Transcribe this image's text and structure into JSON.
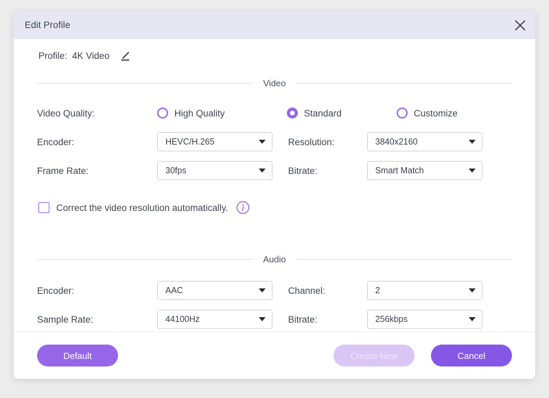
{
  "window": {
    "title": "Edit Profile",
    "close_icon": "close-icon"
  },
  "profile": {
    "label": "Profile:",
    "value": "4K Video",
    "edit_icon": "pencil-icon"
  },
  "video_section": {
    "title": "Video",
    "quality": {
      "label": "Video Quality:",
      "options": [
        {
          "label": "High Quality",
          "selected": false
        },
        {
          "label": "Standard",
          "selected": true
        },
        {
          "label": "Customize",
          "selected": false
        }
      ]
    },
    "encoder": {
      "label": "Encoder:",
      "value": "HEVC/H.265"
    },
    "resolution": {
      "label": "Resolution:",
      "value": "3840x2160"
    },
    "frame_rate": {
      "label": "Frame Rate:",
      "value": "30fps"
    },
    "bitrate": {
      "label": "Bitrate:",
      "value": "Smart Match"
    },
    "auto_correct": {
      "label": "Correct the video resolution automatically.",
      "checked": false,
      "info_icon": "info-icon"
    }
  },
  "audio_section": {
    "title": "Audio",
    "encoder": {
      "label": "Encoder:",
      "value": "AAC"
    },
    "channel": {
      "label": "Channel:",
      "value": "2"
    },
    "sample_rate": {
      "label": "Sample Rate:",
      "value": "44100Hz"
    },
    "bitrate": {
      "label": "Bitrate:",
      "value": "256kbps"
    }
  },
  "footer": {
    "default_label": "Default",
    "create_new_label": "Create New",
    "cancel_label": "Cancel"
  },
  "colors": {
    "accent": "#9766e8",
    "accent_dark": "#8657e6",
    "accent_disabled": "#d9c6f5",
    "titlebar_bg": "#e7e7f4",
    "page_bg": "#ececed"
  }
}
